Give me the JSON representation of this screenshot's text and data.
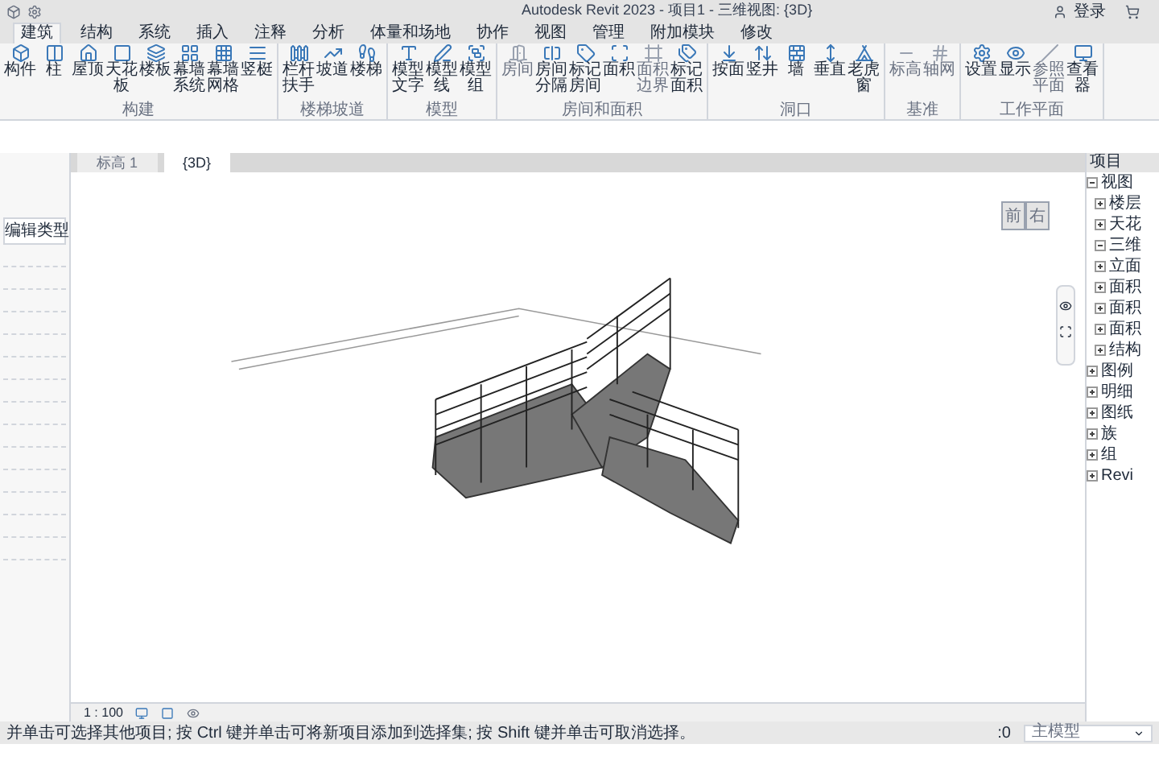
{
  "window": {
    "title": "Autodesk Revit 2023 - 项目1 - 三维视图: {3D}"
  },
  "user": {
    "label": "登录"
  },
  "menu_tabs": [
    {
      "label": "建筑",
      "selected": true
    },
    {
      "label": "结构",
      "selected": false
    },
    {
      "label": "系统",
      "selected": false
    },
    {
      "label": "插入",
      "selected": false
    },
    {
      "label": "注释",
      "selected": false
    },
    {
      "label": "分析",
      "selected": false
    },
    {
      "label": "体量和场地",
      "selected": false
    },
    {
      "label": "协作",
      "selected": false
    },
    {
      "label": "视图",
      "selected": false
    },
    {
      "label": "管理",
      "selected": false
    },
    {
      "label": "附加模块",
      "selected": false
    },
    {
      "label": "修改",
      "selected": false
    }
  ],
  "ribbon": {
    "groups": [
      {
        "label": "构建",
        "buttons": [
          {
            "label": "构件",
            "disabled": false
          },
          {
            "label": "柱",
            "disabled": false
          },
          {
            "label": "屋顶",
            "disabled": false
          },
          {
            "label": "天花板",
            "disabled": false
          },
          {
            "label": "楼板",
            "disabled": false
          },
          {
            "label": "幕墙系统",
            "disabled": false
          },
          {
            "label": "幕墙网格",
            "disabled": false
          },
          {
            "label": "竖梃",
            "disabled": false
          }
        ]
      },
      {
        "label": "楼梯坡道",
        "buttons": [
          {
            "label": "栏杆扶手",
            "disabled": false
          },
          {
            "label": "坡道",
            "disabled": false
          },
          {
            "label": "楼梯",
            "disabled": false
          }
        ]
      },
      {
        "label": "模型",
        "buttons": [
          {
            "label": "模型文字",
            "disabled": false
          },
          {
            "label": "模型线",
            "disabled": false
          },
          {
            "label": "模型组",
            "disabled": false
          }
        ]
      },
      {
        "label": "房间和面积",
        "buttons": [
          {
            "label": "房间",
            "disabled": true
          },
          {
            "label": "房间分隔",
            "disabled": false
          },
          {
            "label": "标记房间",
            "disabled": false
          },
          {
            "label": "面积",
            "disabled": false
          },
          {
            "label": "面积边界",
            "disabled": true
          },
          {
            "label": "标记面积",
            "disabled": false
          }
        ]
      },
      {
        "label": "洞口",
        "buttons": [
          {
            "label": "按面",
            "disabled": false
          },
          {
            "label": "竖井",
            "disabled": false
          },
          {
            "label": "墙",
            "disabled": false
          },
          {
            "label": "垂直",
            "disabled": false
          },
          {
            "label": "老虎窗",
            "disabled": false
          }
        ]
      },
      {
        "label": "基准",
        "buttons": [
          {
            "label": "标高",
            "disabled": true
          },
          {
            "label": "轴网",
            "disabled": true
          }
        ]
      },
      {
        "label": "工作平面",
        "buttons": [
          {
            "label": "设置",
            "disabled": false
          },
          {
            "label": "显示",
            "disabled": false
          },
          {
            "label": "参照平面",
            "disabled": true
          },
          {
            "label": "查看器",
            "disabled": false
          }
        ]
      }
    ]
  },
  "view_tabs": [
    {
      "label": "标高 1",
      "selected": false
    },
    {
      "label": "{3D}",
      "selected": true
    }
  ],
  "properties": {
    "edit_type_button": "编辑类型"
  },
  "project_browser": {
    "title": "项目",
    "tree": [
      {
        "label": "视图",
        "expanded": true,
        "children": [
          {
            "label": "楼层",
            "expanded": false
          },
          {
            "label": "天花",
            "expanded": false
          },
          {
            "label": "三维",
            "expanded": true
          },
          {
            "label": "立面",
            "expanded": false
          },
          {
            "label": "面积",
            "expanded": false
          },
          {
            "label": "面积",
            "expanded": false
          },
          {
            "label": "面积",
            "expanded": false
          },
          {
            "label": "结构",
            "expanded": false
          }
        ]
      },
      {
        "label": "图例",
        "expanded": false
      },
      {
        "label": "明细",
        "expanded": false
      },
      {
        "label": "图纸",
        "expanded": false
      },
      {
        "label": "族",
        "expanded": false
      },
      {
        "label": "组",
        "expanded": false
      },
      {
        "label": "Revi",
        "expanded": false
      }
    ]
  },
  "view_cube": {
    "faces": [
      "前",
      "右"
    ]
  },
  "view_control_bar": {
    "scale": "1 : 100"
  },
  "status_bar": {
    "message": "并单击可选择其他项目; 按 Ctrl 键并单击可将新项目添加到选择集; 按 Shift 键并单击可取消选择。",
    "count": ":0",
    "model": "主模型"
  }
}
